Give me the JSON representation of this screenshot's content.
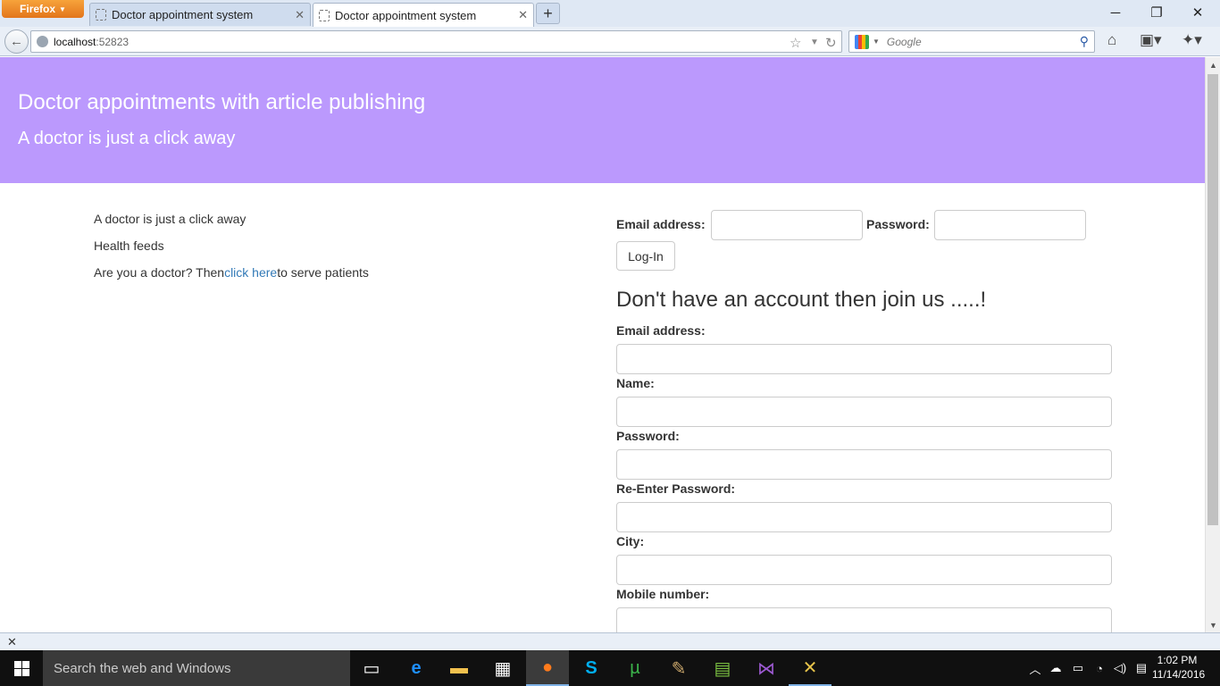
{
  "browser": {
    "app_button": "Firefox",
    "tabs": [
      {
        "title": "Doctor appointment system",
        "active": false
      },
      {
        "title": "Doctor appointment system",
        "active": true
      }
    ],
    "url_host": "localhost",
    "url_port": ":52823",
    "search_placeholder": "Google"
  },
  "page": {
    "title": "Doctor appointments with article publishing",
    "tagline": "A doctor is just a click away",
    "side_links": {
      "item1": "A doctor is just a click away",
      "item2": "Health feeds",
      "doctor_prefix": "Are you a doctor? Then",
      "doctor_link": "click here",
      "doctor_suffix": "to serve patients"
    },
    "login": {
      "email_label": "Email address:",
      "password_label": "Password:",
      "button": "Log-In"
    },
    "register": {
      "heading": "Don't have an account then join us .....!",
      "fields": [
        {
          "label": "Email address:"
        },
        {
          "label": "Name:"
        },
        {
          "label": "Password:"
        },
        {
          "label": "Re-Enter Password:"
        },
        {
          "label": "City:"
        },
        {
          "label": "Mobile number:"
        }
      ]
    },
    "colors": {
      "header_bg": "#bb99fd",
      "link": "#337ab7"
    }
  },
  "taskbar": {
    "search_placeholder": "Search the web and Windows",
    "time": "1:02 PM",
    "date": "11/14/2016"
  }
}
